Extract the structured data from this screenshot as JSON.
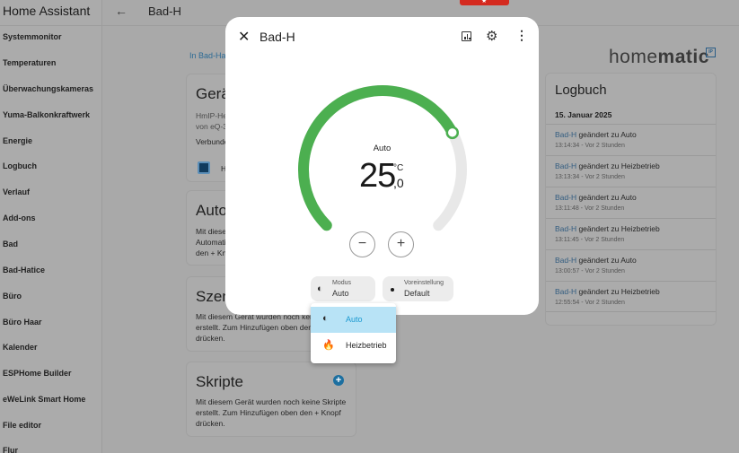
{
  "sidebar": {
    "title": "Home Assistant",
    "items": [
      {
        "label": "Systemmonitor"
      },
      {
        "label": "Temperaturen"
      },
      {
        "label": "Überwachungskameras"
      },
      {
        "label": "Yuma-Balkonkraftwerk"
      },
      {
        "label": "Energie"
      },
      {
        "label": "Logbuch"
      },
      {
        "label": "Verlauf"
      },
      {
        "label": "Add-ons"
      },
      {
        "label": "Bad"
      },
      {
        "label": "Bad-Hatice"
      },
      {
        "label": "Büro"
      },
      {
        "label": "Büro Haar"
      },
      {
        "label": "Kalender"
      },
      {
        "label": "ESPHome Builder"
      },
      {
        "label": "eWeLink Smart Home"
      },
      {
        "label": "File editor"
      },
      {
        "label": "Flur"
      }
    ]
  },
  "topbar": {
    "back_icon": "arrow-left-icon",
    "title": "Bad-H"
  },
  "device_page": {
    "area_link": "In Bad-Hat",
    "device_card": {
      "title": "Gerät",
      "model": "HmIP-He",
      "manufacturer": "von eQ-3",
      "connected": "Verbunde",
      "integration": "H"
    },
    "automations_card": {
      "title": "Autor",
      "text": [
        "Mit diese",
        "Automati",
        "den + Kno"
      ]
    },
    "scenes_card": {
      "title": "Szene",
      "text": [
        "Mit diesem Gerät wurden noch keine",
        "erstellt. Zum Hinzufügen oben den",
        "drücken."
      ]
    },
    "scripts_card": {
      "title": "Skripte",
      "text": [
        "Mit diesem Gerät wurden noch keine Skripte",
        "erstellt. Zum Hinzufügen oben den + Knopf",
        "drücken."
      ],
      "add_icon": "plus-circle-icon"
    },
    "brand": {
      "light": "home",
      "bold": "matic",
      "badge": "IP"
    }
  },
  "logbook": {
    "title": "Logbuch",
    "date": "15. Januar 2025",
    "entries": [
      {
        "entity": "Bad-H",
        "text": " geändert zu Auto",
        "time": "13:14:34 - Vor 2 Stunden"
      },
      {
        "entity": "Bad-H",
        "text": " geändert zu Heizbetrieb",
        "time": "13:13:34 - Vor 2 Stunden"
      },
      {
        "entity": "Bad-H",
        "text": " geändert zu Auto",
        "time": "13:11:48 - Vor 2 Stunden"
      },
      {
        "entity": "Bad-H",
        "text": " geändert zu Heizbetrieb",
        "time": "13:11:45 - Vor 2 Stunden"
      },
      {
        "entity": "Bad-H",
        "text": " geändert zu Auto",
        "time": "13:00:57 - Vor 2 Stunden"
      },
      {
        "entity": "Bad-H",
        "text": " geändert zu Heizbetrieb",
        "time": "12:55:54 - Vor 2 Stunden"
      }
    ]
  },
  "dialog": {
    "title": "Bad-H",
    "close_icon": "close-icon",
    "history_icon": "chart-box-icon",
    "settings_icon": "gear-icon",
    "more_icon": "dots-vertical-icon",
    "thermostat": {
      "mode": "Auto",
      "target_integer": "25",
      "target_decimal": ",0",
      "unit": "°C",
      "target_fraction_of_range": 0.73,
      "accent_color": "#4caf50",
      "track_color": "#e8e8e8",
      "minus_label": "−",
      "plus_label": "+"
    },
    "chips": {
      "mode": {
        "label": "Modus",
        "value": "Auto",
        "icon": "thermostat-auto-icon"
      },
      "preset": {
        "label": "Voreinstellung",
        "value": "Default",
        "icon": "dot-icon"
      }
    }
  },
  "dropdown": {
    "options": [
      {
        "label": "Auto",
        "icon": "thermostat-auto-icon",
        "selected": true
      },
      {
        "label": "Heizbetrieb",
        "icon": "fire-icon",
        "selected": false
      }
    ],
    "selected_color": "#1b9ad1"
  }
}
